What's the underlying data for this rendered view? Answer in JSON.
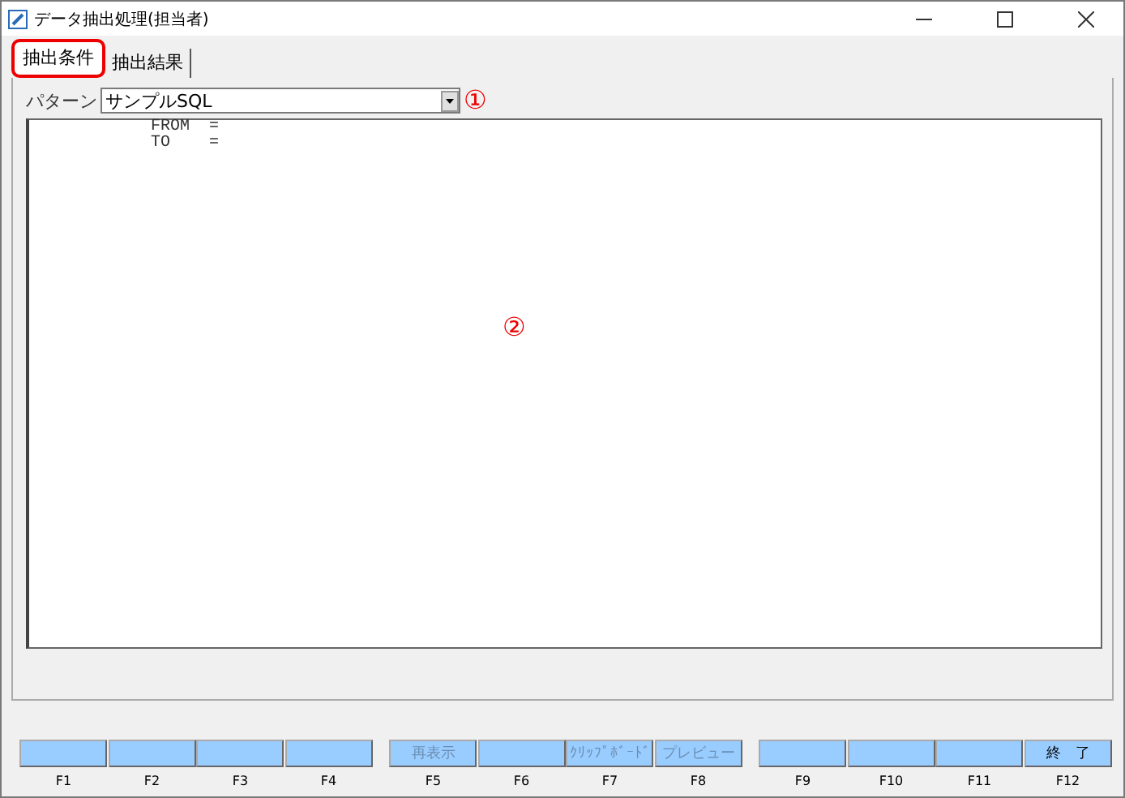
{
  "window": {
    "title": "データ抽出処理(担当者)"
  },
  "tabs": [
    {
      "label": "抽出条件",
      "selected": true,
      "annotated": true
    },
    {
      "label": "抽出結果",
      "selected": false,
      "annotated": false
    }
  ],
  "pattern": {
    "label": "パターン",
    "value": "サンプルSQL",
    "marker": "①"
  },
  "editor": {
    "lines": [
      "FROM  =",
      "TO    ="
    ],
    "marker": "②"
  },
  "function_keys": [
    {
      "key": "F1"
    },
    {
      "key": "F2"
    },
    {
      "key": "F3"
    },
    {
      "key": "F4"
    },
    {
      "key": "F5",
      "label": "再表示",
      "disabled": true
    },
    {
      "key": "F6"
    },
    {
      "key": "F7",
      "label": "ｸﾘｯﾌﾟﾎﾞｰﾄﾞ",
      "disabled": true
    },
    {
      "key": "F8",
      "label": "プレビュー",
      "disabled": true
    },
    {
      "key": "F9"
    },
    {
      "key": "F10"
    },
    {
      "key": "F11"
    },
    {
      "key": "F12",
      "label": "終　了",
      "disabled": false
    }
  ]
}
